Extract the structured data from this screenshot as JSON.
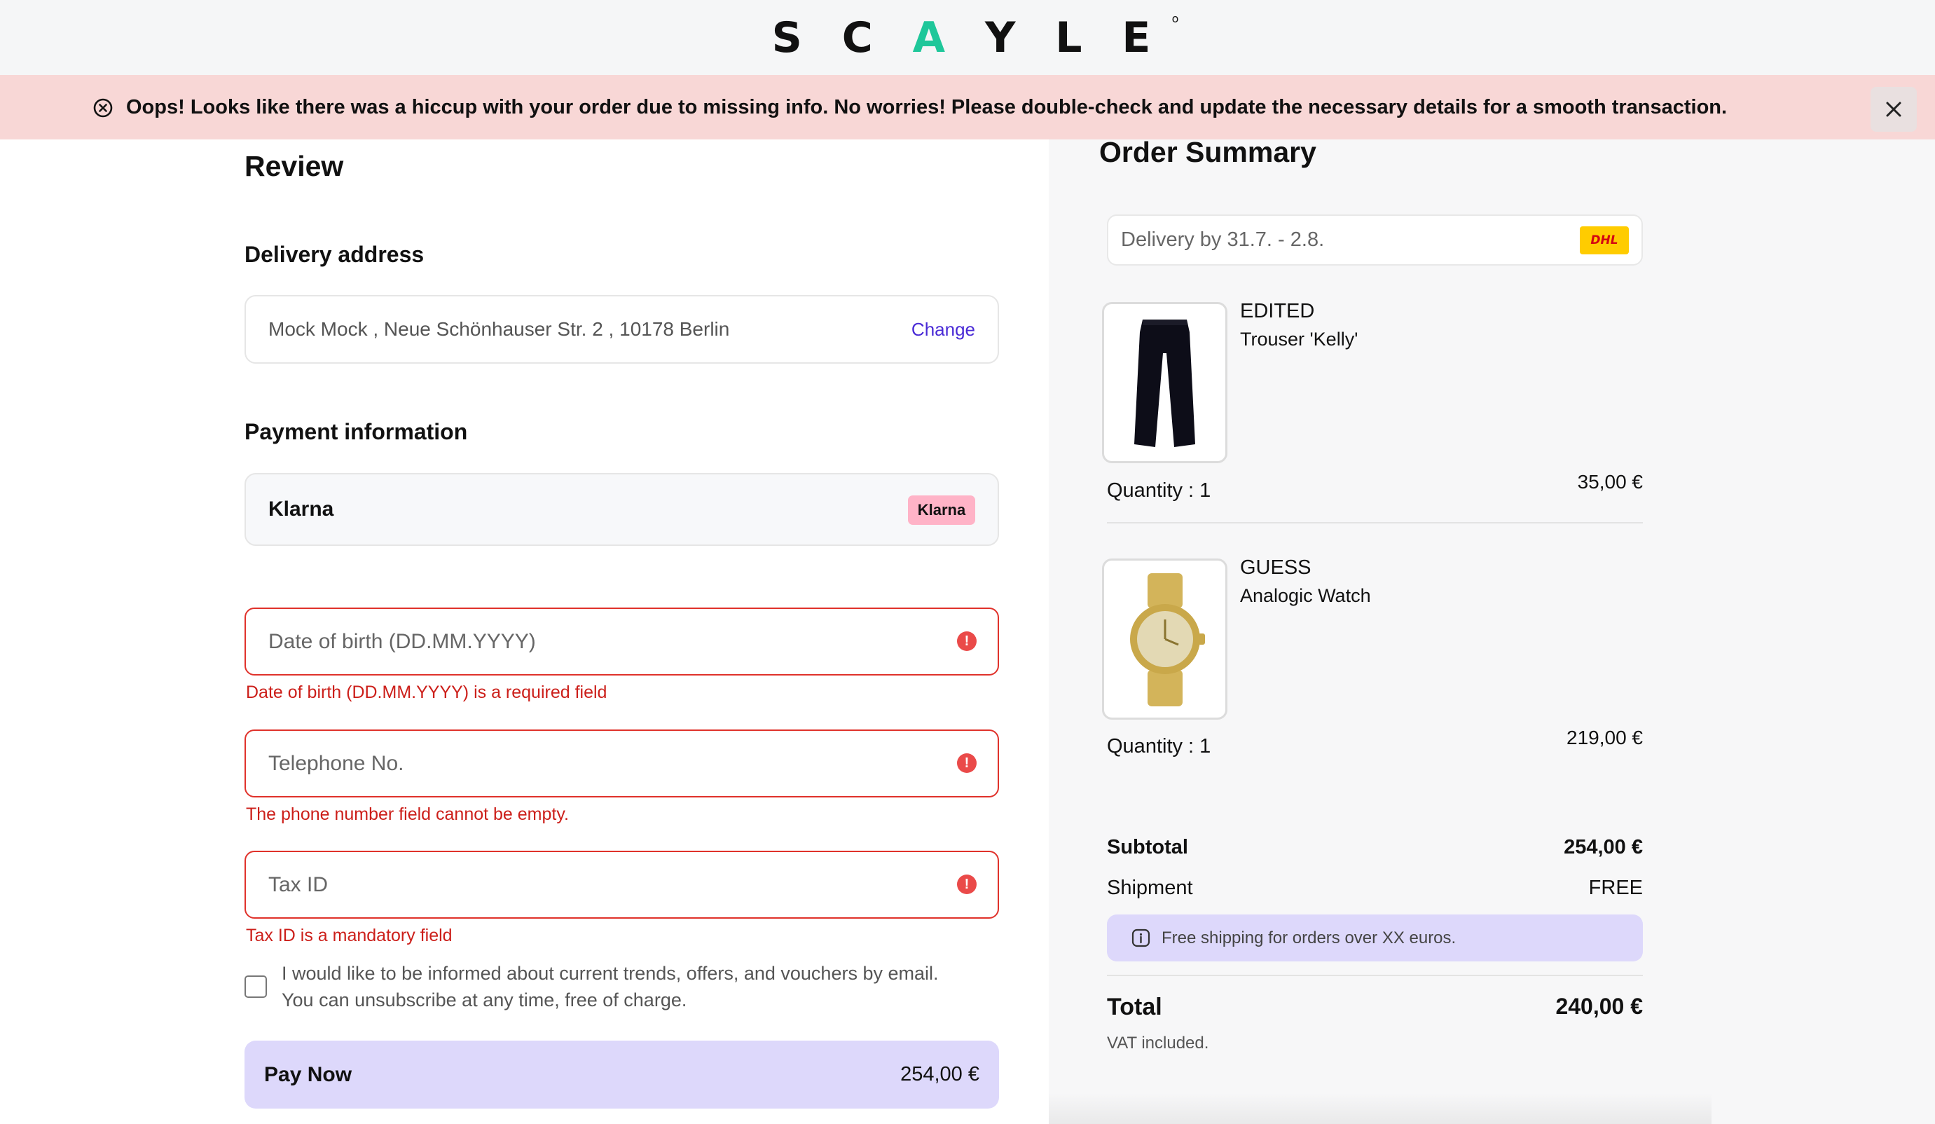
{
  "header": {
    "logo": "SCAYLE"
  },
  "banner": {
    "message": "Oops! Looks like there was a hiccup with your order due to missing info. No worries! Please double-check and update the necessary details for a smooth transaction.",
    "icon": "x-circle-icon",
    "close_icon": "close-icon"
  },
  "review": {
    "title": "Review",
    "delivery": {
      "heading": "Delivery address",
      "address": "Mock Mock , Neue Schönhauser Str. 2 , 10178 Berlin",
      "change_label": "Change"
    },
    "payment": {
      "heading": "Payment information",
      "method": "Klarna",
      "badge": "Klarna"
    },
    "fields": [
      {
        "placeholder": "Date of birth (DD.MM.YYYY)",
        "error": "Date of birth (DD.MM.YYYY) is a required field"
      },
      {
        "placeholder": "Telephone No.",
        "error": "The phone number field cannot be empty."
      },
      {
        "placeholder": "Tax ID",
        "error": "Tax ID is a mandatory field"
      }
    ],
    "newsletter": {
      "checked": false,
      "line1": "I would like to be informed about current trends, offers, and vouchers by email.",
      "line2": "You can unsubscribe at any time, free of charge."
    },
    "pay_button": {
      "label": "Pay Now",
      "amount": "254,00 €"
    }
  },
  "summary": {
    "title": "Order Summary",
    "delivery_estimate": "Delivery by 31.7. - 2.8.",
    "carrier": "DHL",
    "items": [
      {
        "brand": "EDITED",
        "name": "Trouser 'Kelly'",
        "quantity": "Quantity : 1",
        "price": "35,00 €"
      },
      {
        "brand": "GUESS",
        "name": "Analogic Watch",
        "quantity": "Quantity : 1",
        "price": "219,00 €"
      }
    ],
    "subtotal_label": "Subtotal",
    "subtotal_value": "254,00 €",
    "shipment_label": "Shipment",
    "shipment_value": "FREE",
    "free_shipping_note": "Free shipping for orders over XX euros.",
    "total_label": "Total",
    "total_value": "240,00 €",
    "vat_note": "VAT included."
  },
  "colors": {
    "brand_accent": "#1fc79a",
    "error": "#e0322b",
    "error_banner_bg": "#f8d7d6",
    "pay_button_bg": "#ddd8fb",
    "link": "#4a2bd6",
    "klarna_pink": "#ffb3c7"
  }
}
